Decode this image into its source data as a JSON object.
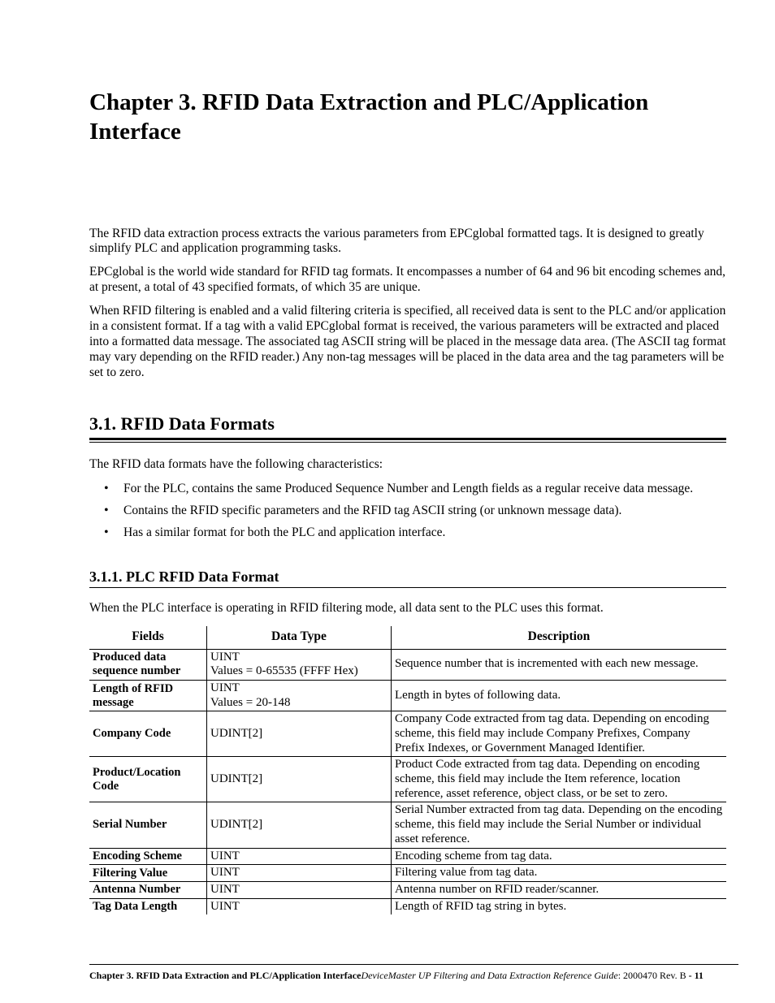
{
  "chapter": {
    "title": "Chapter 3.  RFID Data Extraction and PLC/Application Interface"
  },
  "intro": {
    "p1": "The RFID data extraction process extracts the various parameters from EPCglobal formatted tags. It is designed to greatly simplify PLC and application programming tasks.",
    "p2": "EPCglobal is the world wide standard for RFID tag formats. It encompasses a number of 64 and 96 bit encoding schemes and, at present, a total of 43 specified formats, of which 35 are unique.",
    "p3": "When RFID filtering is enabled and a valid filtering criteria is specified, all received data is sent to the PLC and/or application in a consistent format. If a tag with a valid EPCglobal format is received, the various parameters will be extracted and placed into a formatted data message. The associated tag ASCII string will be placed in the message data area. (The ASCII tag format may vary depending on the RFID reader.) Any non-tag messages will be placed in the data area and the tag parameters will be set to zero."
  },
  "section_3_1": {
    "heading": "3.1.   RFID Data Formats",
    "p1": "The RFID data formats have the following characteristics:",
    "bullets": [
      "For the PLC, contains the same Produced Sequence Number and Length fields as a regular receive data message.",
      "Contains the RFID specific parameters and the RFID tag ASCII string (or unknown message data).",
      "Has a similar format for both the PLC and application interface."
    ]
  },
  "section_3_1_1": {
    "heading": "3.1.1.    PLC RFID Data Format",
    "p1": "When the PLC interface is operating in RFID filtering mode, all data sent to the PLC uses this format.",
    "table": {
      "headers": [
        "Fields",
        "Data Type",
        "Description"
      ],
      "rows": [
        {
          "field": "Produced data sequence number",
          "dtype": "UINT\nValues = 0-65535 (FFFF Hex)",
          "desc": "Sequence number that is incremented with each new message."
        },
        {
          "field": "Length of RFID message",
          "dtype": "UINT\nValues = 20-148",
          "desc": "Length in bytes of following data."
        },
        {
          "field": "Company Code",
          "dtype": "UDINT[2]",
          "desc": "Company Code extracted from tag data. Depending on encoding scheme, this field may include Company Prefixes, Company Prefix Indexes, or Government Managed Identifier."
        },
        {
          "field": "Product/Location Code",
          "dtype": "UDINT[2]",
          "desc": "Product Code extracted from tag data. Depending on encoding scheme, this field may include the Item reference, location reference, asset reference, object class, or be set to zero."
        },
        {
          "field": "Serial Number",
          "dtype": "UDINT[2]",
          "desc": "Serial Number extracted from tag data. Depending on the encoding scheme, this field may include the Serial Number or individual asset reference."
        },
        {
          "field": "Encoding Scheme",
          "dtype": "UINT",
          "desc": "Encoding scheme from tag data."
        },
        {
          "field": "Filtering Value",
          "dtype": "UINT",
          "desc": "Filtering value from tag data."
        },
        {
          "field": "Antenna Number",
          "dtype": "UINT",
          "desc": "Antenna number on RFID reader/scanner."
        },
        {
          "field": "Tag Data Length",
          "dtype": "UINT",
          "desc": "Length of RFID tag string in bytes."
        }
      ]
    }
  },
  "footer": {
    "bold": "Chapter 3. RFID Data Extraction and PLC/Application Interface",
    "italic": "DeviceMaster UP Filtering and Data Extraction Reference Guide",
    "tail": ": 2000470 Rev. B ",
    "page_bold": "- 11"
  }
}
